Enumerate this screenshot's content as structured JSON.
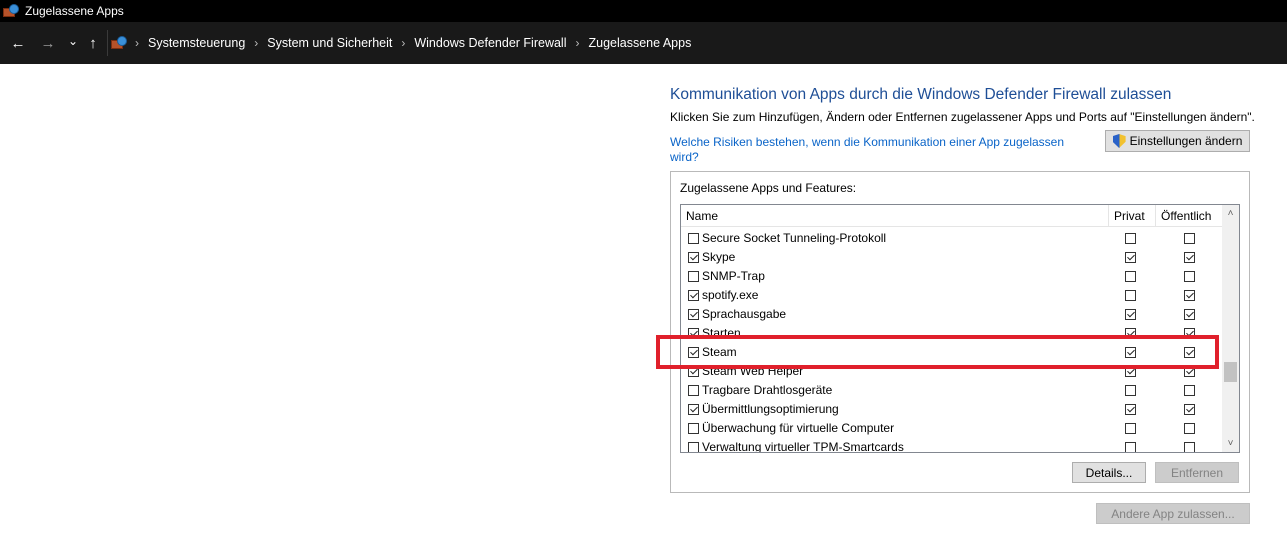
{
  "window": {
    "title": "Zugelassene Apps",
    "app_icon": "firewall-icon"
  },
  "addressbar": {
    "back_icon": "←",
    "forward_icon": "→",
    "recent_icon": "⌄",
    "up_icon": "↑",
    "breadcrumbs": [
      "Systemsteuerung",
      "System und Sicherheit",
      "Windows Defender Firewall",
      "Zugelassene Apps"
    ],
    "separator": "›"
  },
  "main": {
    "heading": "Kommunikation von Apps durch die Windows Defender Firewall zulassen",
    "description": "Klicken Sie zum Hinzufügen, Ändern oder Entfernen zugelassener Apps und Ports auf \"Einstellungen ändern\".",
    "risk_link": "Welche Risiken bestehen, wenn die Kommunikation einer App zugelassen wird?",
    "settings_button": "Einstellungen ändern",
    "group_label": "Zugelassene Apps und Features:",
    "columns": {
      "name": "Name",
      "private": "Privat",
      "public": "Öffentlich"
    },
    "rows": [
      {
        "name": "Secure Socket Tunneling-Protokoll",
        "enabled": false,
        "private": false,
        "public": false
      },
      {
        "name": "Skype",
        "enabled": true,
        "private": true,
        "public": true
      },
      {
        "name": "SNMP-Trap",
        "enabled": false,
        "private": false,
        "public": false
      },
      {
        "name": "spotify.exe",
        "enabled": true,
        "private": false,
        "public": true
      },
      {
        "name": "Sprachausgabe",
        "enabled": true,
        "private": true,
        "public": true
      },
      {
        "name": "Starten",
        "enabled": true,
        "private": true,
        "public": true
      },
      {
        "name": "Steam",
        "enabled": true,
        "private": true,
        "public": true
      },
      {
        "name": "Steam Web Helper",
        "enabled": true,
        "private": true,
        "public": true
      },
      {
        "name": "Tragbare Drahtlosgeräte",
        "enabled": false,
        "private": false,
        "public": false
      },
      {
        "name": "Übermittlungsoptimierung",
        "enabled": true,
        "private": true,
        "public": true
      },
      {
        "name": "Überwachung für virtuelle Computer",
        "enabled": false,
        "private": false,
        "public": false
      },
      {
        "name": "Verwaltung virtueller TPM-Smartcards",
        "enabled": false,
        "private": false,
        "public": false
      }
    ],
    "details_button": "Details...",
    "remove_button": "Entfernen",
    "allow_other_button": "Andere App zulassen...",
    "scroll_up_icon": "˄",
    "scroll_down_icon": "˅",
    "highlight_color": "#e0202b"
  }
}
